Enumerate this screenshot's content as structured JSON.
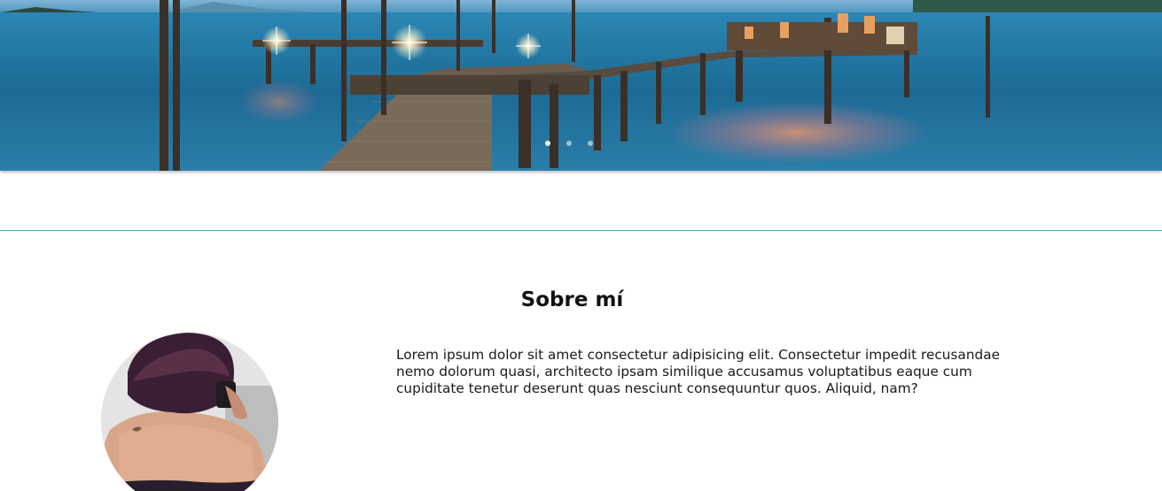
{
  "hero": {
    "image": "pier-at-dusk-photo",
    "carousel": {
      "slides": 3,
      "active_index": 0
    }
  },
  "about": {
    "title": "Sobre mí",
    "avatar": "woman-with-camera-photo",
    "text": "Lorem ipsum dolor sit amet consectetur adipisicing elit. Consectetur impedit recusandae nemo dolorum quasi, architecto ipsam similique accusamus voluptatibus eaque cum cupiditate tenetur deserunt quas nesciunt consequuntur quos. Aliquid, nam?"
  },
  "colors": {
    "divider": "#4fa5a6",
    "water": "#1f6d98",
    "text": "#111111"
  }
}
